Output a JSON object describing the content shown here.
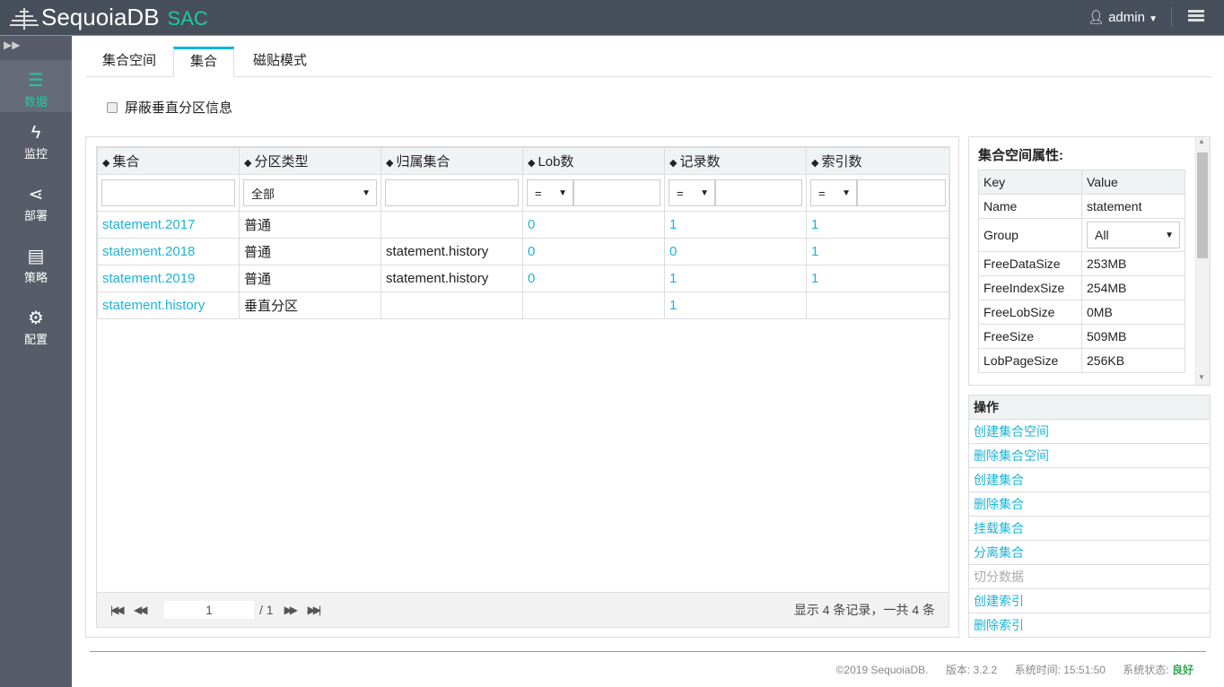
{
  "header": {
    "brand": "SequoiaDB",
    "product": "SAC",
    "user": "admin"
  },
  "sidebar": {
    "items": [
      {
        "label": "数据",
        "icon": "database-icon",
        "active": true
      },
      {
        "label": "监控",
        "icon": "bolt-icon"
      },
      {
        "label": "部署",
        "icon": "share-icon"
      },
      {
        "label": "策略",
        "icon": "server-icon"
      },
      {
        "label": "配置",
        "icon": "gears-icon"
      }
    ]
  },
  "tabs": [
    {
      "label": "集合空间"
    },
    {
      "label": "集合",
      "active": true
    },
    {
      "label": "磁贴模式"
    }
  ],
  "filter_checkbox": {
    "label": "屏蔽垂直分区信息",
    "checked": false
  },
  "table": {
    "columns": [
      "集合",
      "分区类型",
      "归属集合",
      "Lob数",
      "记录数",
      "索引数"
    ],
    "filters": {
      "type_select": "全部",
      "op": "="
    },
    "rows": [
      {
        "name": "statement.2017",
        "type": "普通",
        "parent": "",
        "lob": "0",
        "records": "1",
        "indexes": "1"
      },
      {
        "name": "statement.2018",
        "type": "普通",
        "parent": "statement.history",
        "lob": "0",
        "records": "0",
        "indexes": "1"
      },
      {
        "name": "statement.2019",
        "type": "普通",
        "parent": "statement.history",
        "lob": "0",
        "records": "1",
        "indexes": "1"
      },
      {
        "name": "statement.history",
        "type": "垂直分区",
        "parent": "",
        "lob": "",
        "records": "1",
        "indexes": ""
      }
    ],
    "pager": {
      "page": "1",
      "total": "/ 1",
      "info": "显示 4 条记录，一共 4 条"
    }
  },
  "props": {
    "title": "集合空间属性:",
    "key_header": "Key",
    "value_header": "Value",
    "rows": [
      {
        "k": "Name",
        "v": "statement"
      },
      {
        "k": "Group",
        "v": "All"
      },
      {
        "k": "FreeDataSize",
        "v": "253MB"
      },
      {
        "k": "FreeIndexSize",
        "v": "254MB"
      },
      {
        "k": "FreeLobSize",
        "v": "0MB"
      },
      {
        "k": "FreeSize",
        "v": "509MB"
      },
      {
        "k": "LobPageSize",
        "v": "256KB"
      }
    ]
  },
  "ops": {
    "title": "操作",
    "items": [
      {
        "label": "创建集合空间"
      },
      {
        "label": "删除集合空间"
      },
      {
        "label": "创建集合"
      },
      {
        "label": "删除集合"
      },
      {
        "label": "挂载集合"
      },
      {
        "label": "分离集合"
      },
      {
        "label": "切分数据",
        "disabled": true
      },
      {
        "label": "创建索引"
      },
      {
        "label": "删除索引"
      }
    ]
  },
  "footer": {
    "copyright": "©2019 SequoiaDB.",
    "version": "版本: 3.2.2",
    "time": "系统时间: 15:51:50",
    "status_label": "系统状态:",
    "status": "良好"
  },
  "colors": {
    "accent": "#1db4d8",
    "brand_green": "#1ec8a0",
    "ok": "#2ea84a"
  }
}
